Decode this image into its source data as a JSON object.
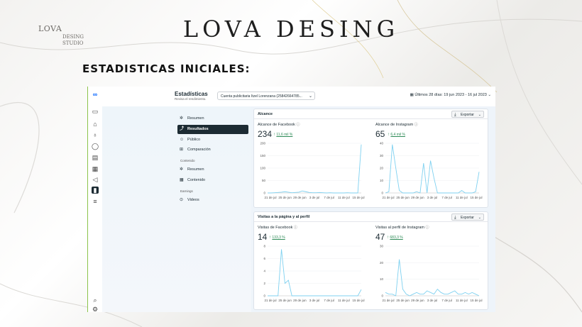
{
  "logo": {
    "line1": "LOVA",
    "line2": "DESING",
    "line3": "STUDIO"
  },
  "brand_title": "LOVA DESING",
  "heading": "ESTADISTICAS INICIALES:",
  "app": {
    "title": "Estadísticas",
    "subtitle": "Revisa el rendimiento.",
    "account_selector": "Cuenta publicitaria Itzel Lorenzana (25842664785...",
    "date_range": "Últimos 28 días: 19 jun 2023 - 16 jul 2023",
    "rail_icons": [
      "meta-logo-icon",
      "placeholder-icon",
      "home-icon",
      "notification-icon",
      "chat-icon",
      "calendar-icon",
      "grid-icon",
      "megaphone-icon",
      "insights-icon",
      "menu-icon",
      "search-icon",
      "settings-icon"
    ],
    "nav": {
      "resumen": "Resumen",
      "resultados": "Resultados",
      "publico": "Público",
      "comparacion": "Comparación",
      "contenido_section": "Contenido",
      "contenido_resumen": "Resumen",
      "contenido": "Contenido",
      "earnings_section": "Earnings",
      "videos": "Videos"
    },
    "export_label": "Exportar",
    "card_alcance": {
      "title": "Alcance",
      "facebook": {
        "label": "Alcance de Facebook",
        "value": "234",
        "delta": "11,6 mil %"
      },
      "instagram": {
        "label": "Alcance de Instagram",
        "value": "65",
        "delta": "6,4 mil %"
      }
    },
    "card_visitas": {
      "title": "Visitas a la página y al perfil",
      "facebook": {
        "label": "Visitas de Facebook",
        "value": "14",
        "delta": "133,3 %"
      },
      "instagram": {
        "label": "Visitas al perfil de Instagram",
        "value": "47",
        "delta": "683,3 %"
      }
    }
  },
  "chart_data": [
    {
      "type": "line",
      "title": "Alcance de Facebook",
      "x_ticks": [
        "21 de jul",
        "25 de jun",
        "29 de jun",
        "3 de jul",
        "7 de jul",
        "11 de jul",
        "15 de jul"
      ],
      "ylim": [
        0,
        200
      ],
      "y_ticks": [
        0,
        50,
        100,
        150,
        200
      ],
      "values": [
        0,
        0,
        1,
        2,
        3,
        5,
        3,
        1,
        2,
        3,
        8,
        5,
        2,
        1,
        1,
        2,
        1,
        0,
        1,
        0,
        0,
        0,
        0,
        1,
        0,
        0,
        0,
        195
      ],
      "color": "#7fd1f0"
    },
    {
      "type": "line",
      "title": "Alcance de Instagram",
      "x_ticks": [
        "21 de jul",
        "25 de jun",
        "29 de jun",
        "3 de jul",
        "7 de jul",
        "11 de jul",
        "15 de jul"
      ],
      "ylim": [
        0,
        40
      ],
      "y_ticks": [
        0,
        10,
        20,
        30,
        40
      ],
      "values": [
        0,
        1,
        39,
        20,
        2,
        0,
        0,
        0,
        0,
        1,
        0,
        24,
        0,
        26,
        12,
        0,
        0,
        0,
        0,
        0,
        0,
        0,
        2,
        0,
        0,
        0,
        1,
        17
      ],
      "color": "#7fd1f0"
    },
    {
      "type": "line",
      "title": "Visitas de Facebook",
      "x_ticks": [
        "21 de jul",
        "25 de jun",
        "29 de jun",
        "3 de jul",
        "7 de jul",
        "11 de jul",
        "15 de jul"
      ],
      "ylim": [
        0,
        8
      ],
      "y_ticks": [
        0,
        2,
        4,
        6,
        8
      ],
      "values": [
        0,
        0,
        0,
        0,
        7.5,
        2,
        2.5,
        0,
        0,
        0,
        0,
        0,
        0,
        0,
        0,
        0,
        0,
        0,
        0,
        0,
        0,
        0,
        0,
        0,
        0,
        0,
        0,
        1
      ],
      "color": "#7fd1f0"
    },
    {
      "type": "line",
      "title": "Visitas al perfil de Instagram",
      "x_ticks": [
        "21 de jul",
        "25 de jun",
        "29 de jun",
        "3 de jul",
        "7 de jul",
        "11 de jul",
        "15 de jul"
      ],
      "ylim": [
        0,
        30
      ],
      "y_ticks": [
        0,
        10,
        20,
        30
      ],
      "values": [
        2,
        1,
        1,
        0,
        22,
        4,
        1,
        0,
        1,
        2,
        1,
        1,
        3,
        2,
        1,
        4,
        2,
        1,
        1,
        2,
        3,
        1,
        1,
        2,
        1,
        2,
        1,
        0
      ],
      "color": "#7fd1f0"
    }
  ]
}
